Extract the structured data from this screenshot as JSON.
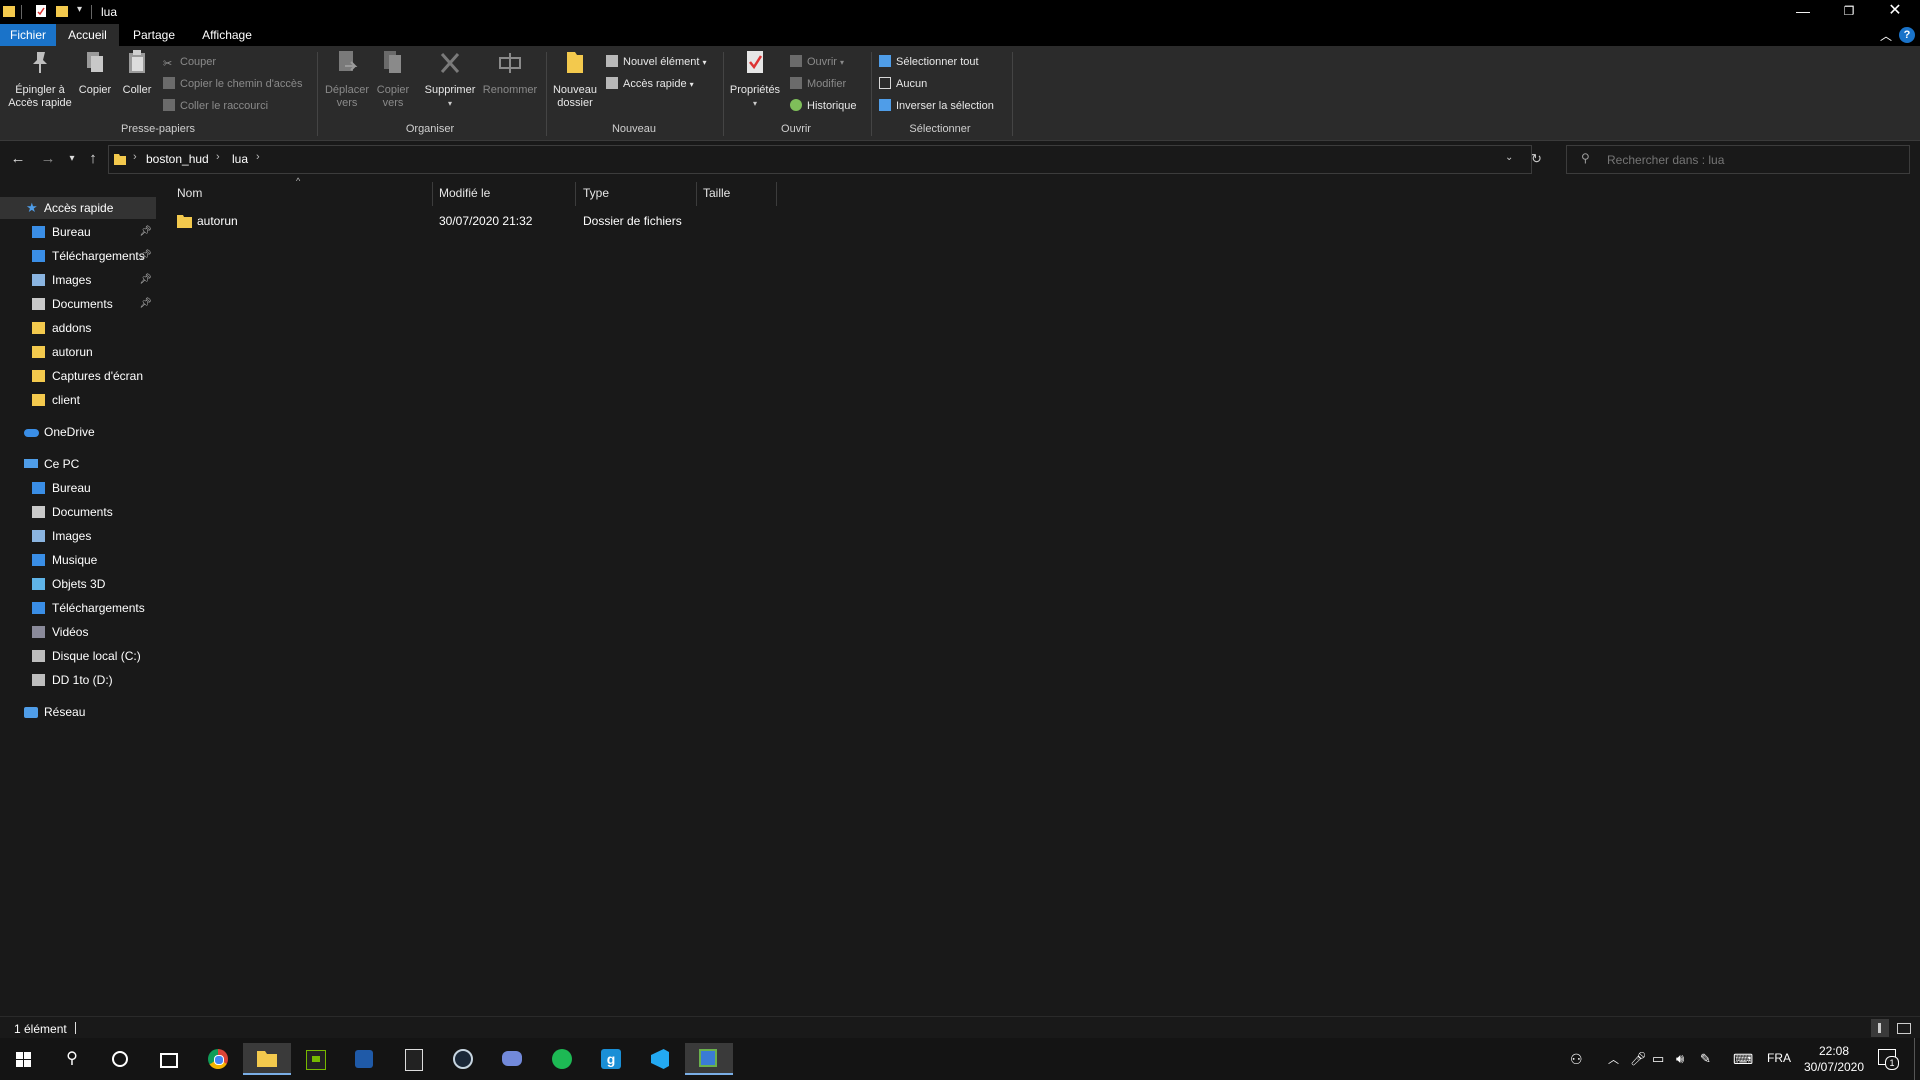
{
  "window": {
    "title": "lua"
  },
  "ribbon_tabs": [
    "Fichier",
    "Accueil",
    "Partage",
    "Affichage"
  ],
  "ribbon": {
    "clipboard": {
      "pin_label": "Épingler à Accès rapide",
      "copy_label": "Copier",
      "paste_label": "Coller",
      "cut_label": "Couper",
      "copy_path_label": "Copier le chemin d'accès",
      "paste_shortcut_label": "Coller le raccourci",
      "group_label": "Presse-papiers"
    },
    "organize": {
      "move_label": "Déplacer vers",
      "copyto_label": "Copier vers",
      "delete_label": "Supprimer",
      "rename_label": "Renommer",
      "group_label": "Organiser"
    },
    "new": {
      "new_folder_label": "Nouveau dossier",
      "new_item_label": "Nouvel élément",
      "easy_access_label": "Accès rapide",
      "group_label": "Nouveau"
    },
    "open": {
      "properties_label": "Propriétés",
      "open_label": "Ouvrir",
      "edit_label": "Modifier",
      "history_label": "Historique",
      "group_label": "Ouvrir"
    },
    "select": {
      "select_all_label": "Sélectionner tout",
      "select_none_label": "Aucun",
      "invert_label": "Inverser la sélection",
      "group_label": "Sélectionner"
    }
  },
  "address": {
    "crumbs": [
      "boston_hud",
      "lua"
    ],
    "search_placeholder": "Rechercher dans : lua"
  },
  "nav": {
    "quick_access": "Accès rapide",
    "quick_items": [
      {
        "label": "Bureau",
        "icon": "desktop-icon",
        "pinned": true
      },
      {
        "label": "Téléchargements",
        "icon": "download-icon",
        "pinned": true
      },
      {
        "label": "Images",
        "icon": "pictures-icon",
        "pinned": true
      },
      {
        "label": "Documents",
        "icon": "documents-icon",
        "pinned": true
      },
      {
        "label": "addons",
        "icon": "folder-icon",
        "pinned": false
      },
      {
        "label": "autorun",
        "icon": "folder-icon",
        "pinned": false
      },
      {
        "label": "Captures d'écran",
        "icon": "folder-icon",
        "pinned": false
      },
      {
        "label": "client",
        "icon": "folder-icon",
        "pinned": false
      }
    ],
    "onedrive": "OneDrive",
    "this_pc": "Ce PC",
    "pc_items": [
      {
        "label": "Bureau",
        "icon": "desktop-icon"
      },
      {
        "label": "Documents",
        "icon": "documents-icon"
      },
      {
        "label": "Images",
        "icon": "pictures-icon"
      },
      {
        "label": "Musique",
        "icon": "music-icon"
      },
      {
        "label": "Objets 3D",
        "icon": "3d-objects-icon"
      },
      {
        "label": "Téléchargements",
        "icon": "download-icon"
      },
      {
        "label": "Vidéos",
        "icon": "videos-icon"
      },
      {
        "label": "Disque local (C:)",
        "icon": "drive-icon"
      },
      {
        "label": "DD 1to (D:)",
        "icon": "drive-icon"
      }
    ],
    "network": "Réseau"
  },
  "columns": [
    "Nom",
    "Modifié le",
    "Type",
    "Taille"
  ],
  "files": [
    {
      "name": "autorun",
      "modified": "30/07/2020 21:32",
      "type": "Dossier de fichiers",
      "size": ""
    }
  ],
  "status": {
    "item_count": "1 élément"
  },
  "taskbar": {
    "lang": "FRA",
    "time": "22:08",
    "date": "30/07/2020",
    "notification_count": "1"
  },
  "colors": {
    "accent": "#1a73c9",
    "folder": "#f3c94d",
    "background": "#191919"
  }
}
